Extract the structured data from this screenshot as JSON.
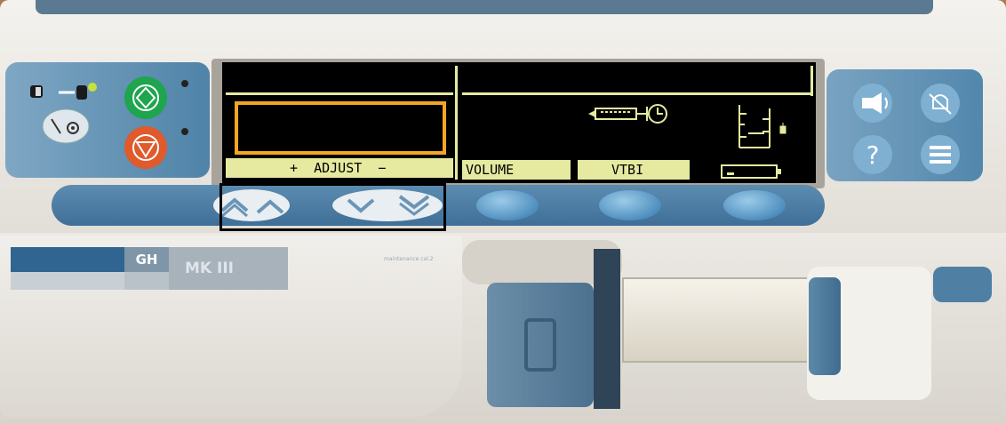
{
  "device": {
    "brand_badge": "GH",
    "model": "MK III",
    "fine_print": "maintenance cal.2"
  },
  "display": {
    "left_soft_label": "+  ADJUST  −",
    "bottom_labels": [
      "VOLUME",
      "VTBI"
    ],
    "icons": [
      "syringe-icon",
      "clock-icon",
      "pressure-scale-icon",
      "battery-icon"
    ]
  },
  "controls": {
    "left_panel": [
      "on-off-icon",
      "power-plug-icon",
      "start-button",
      "stop-button"
    ],
    "arrow_keys": [
      "double-up-arrow",
      "up-arrow",
      "down-arrow",
      "double-down-arrow"
    ],
    "soft_keys": [
      "soft-key-1",
      "soft-key-2",
      "soft-key-3"
    ],
    "right_panel": [
      "silence-alarm-icon",
      "no-alarm-icon",
      "help-icon",
      "menu-icon"
    ]
  },
  "colors": {
    "start": "#1ea54e",
    "stop": "#e05a2b",
    "panel_blue": "#4f83a8",
    "lcd_green": "#e6eaa0",
    "highlight_yellow": "#f2a723"
  }
}
